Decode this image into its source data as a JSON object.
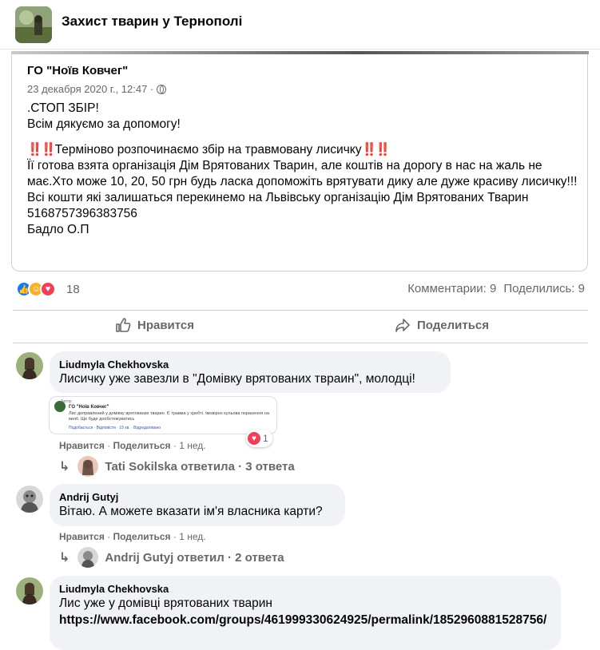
{
  "group": {
    "title": "Захист тварин у Тернополі"
  },
  "shared_post": {
    "author": "ГО \"Ноїв Ковчег\"",
    "date": "23 декабря 2020 г., 12:47 ·",
    "line1": ".СТОП ЗБІР!",
    "line2": "Всім дякуємо за допомогу!",
    "urgent_marks": "‼️‼️",
    "para2": "Терміново розпочинаємо збір на травмовану лисичку",
    "para3": "Її готова взята організація Дім Врятованих Тварин, але коштів на дорогу в нас на жаль не має.Хто може 10, 20, 50 грн будь ласка допоможіть врятувати дику але дуже красиву лисичку!!! Всі кошти які залишаться перекинемо на Львівську організацію Дім Врятованих Тварин",
    "card": "5168757396383756",
    "name": "Бадло О.П"
  },
  "reactions": {
    "count": "18",
    "comments": "Комментарии: 9",
    "shares": "Поделились: 9",
    "colors": {
      "like": "#1877f2",
      "care": "#f7b125",
      "love": "#f33e58"
    }
  },
  "actions": {
    "like": "Нравится",
    "share": "Поделиться"
  },
  "comments": [
    {
      "author": "Liudmyla Chekhovska",
      "text": "Лисичку уже завезли в \"Домівку врятованих твраин\", молодці!",
      "like": "Нравится",
      "reply": "Поделиться",
      "time": "1 нед.",
      "reaction_count": "1",
      "replies_text": "Tati Sokilska ответила · 3 ответа",
      "screenshot": {
        "label": "Автор",
        "author": "ГО \"Ноїв Ковчег\"",
        "text": "Лис доправлений у домівку врятованих тварин. Є травма у хребті. Імовірно кульова поранення на вилії. Ще буде дообстежуватись",
        "footer": "Подобається · Відповісти · 19 хв. · Відредаговано"
      }
    },
    {
      "author": "Andrij Gutyj",
      "text": "Вітаю. А можете вказати ім'я власника карти?",
      "like": "Нравится",
      "reply": "Поделиться",
      "time": "1 нед.",
      "replies_text": "Andrij Gutyj ответил · 2 ответа"
    },
    {
      "author": "Liudmyla Chekhovska",
      "text": "Лис уже у домівці врятованих тварин",
      "link": "https://www.facebook.com/groups/461999330624925/permalink/1852960881528756/"
    }
  ]
}
